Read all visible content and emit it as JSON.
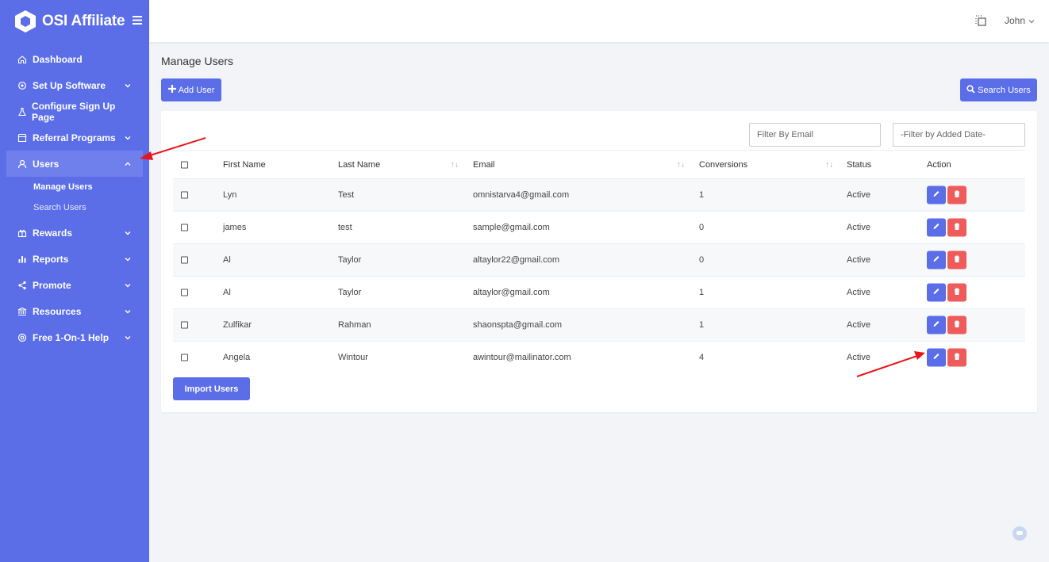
{
  "app": {
    "name": "OSI Affiliate"
  },
  "topbar": {
    "user_name": "John"
  },
  "sidebar": {
    "items": [
      {
        "label": "Dashboard",
        "icon": "home-icon",
        "has_chevron": false
      },
      {
        "label": "Set Up Software",
        "icon": "gear-icon",
        "has_chevron": true
      },
      {
        "label": "Configure Sign Up Page",
        "icon": "flask-icon",
        "has_chevron": false
      },
      {
        "label": "Referral Programs",
        "icon": "store-icon",
        "has_chevron": true
      },
      {
        "label": "Users",
        "icon": "user-icon",
        "has_chevron": true,
        "active": true
      },
      {
        "label": "Rewards",
        "icon": "gift-icon",
        "has_chevron": true
      },
      {
        "label": "Reports",
        "icon": "bar-chart-icon",
        "has_chevron": true
      },
      {
        "label": "Promote",
        "icon": "share-icon",
        "has_chevron": true
      },
      {
        "label": "Resources",
        "icon": "bank-icon",
        "has_chevron": true
      },
      {
        "label": "Free 1-On-1 Help",
        "icon": "lifebuoy-icon",
        "has_chevron": true
      }
    ],
    "users_subitems": [
      {
        "label": "Manage Users",
        "current": true
      },
      {
        "label": "Search Users",
        "current": false
      }
    ]
  },
  "page": {
    "title": "Manage Users",
    "add_button": "Add User",
    "search_button": "Search Users",
    "import_button": "Import Users"
  },
  "filters": {
    "email_placeholder": "Filter By Email",
    "date_placeholder": "-Filter by Added Date-"
  },
  "table": {
    "headers": {
      "first_name": "First Name",
      "last_name": "Last Name",
      "email": "Email",
      "conversions": "Conversions",
      "status": "Status",
      "action": "Action"
    },
    "rows": [
      {
        "first": "Lyn",
        "last": "Test",
        "email": "omnistarva4@gmail.com",
        "conversions": "1",
        "status": "Active"
      },
      {
        "first": "james",
        "last": "test",
        "email": "sample@gmail.com",
        "conversions": "0",
        "status": "Active"
      },
      {
        "first": "Al",
        "last": "Taylor",
        "email": "altaylor22@gmail.com",
        "conversions": "0",
        "status": "Active"
      },
      {
        "first": "Al",
        "last": "Taylor",
        "email": "altaylor@gmail.com",
        "conversions": "1",
        "status": "Active"
      },
      {
        "first": "Zulfikar",
        "last": "Rahman",
        "email": "shaonspta@gmail.com",
        "conversions": "1",
        "status": "Active"
      },
      {
        "first": "Angela",
        "last": "Wintour",
        "email": "awintour@mailinator.com",
        "conversions": "4",
        "status": "Active"
      }
    ]
  },
  "colors": {
    "sidebar": "#5b6ee8",
    "primary": "#5b6ee8",
    "danger": "#ef5b5b",
    "annotation_arrow": "#e8151b"
  }
}
